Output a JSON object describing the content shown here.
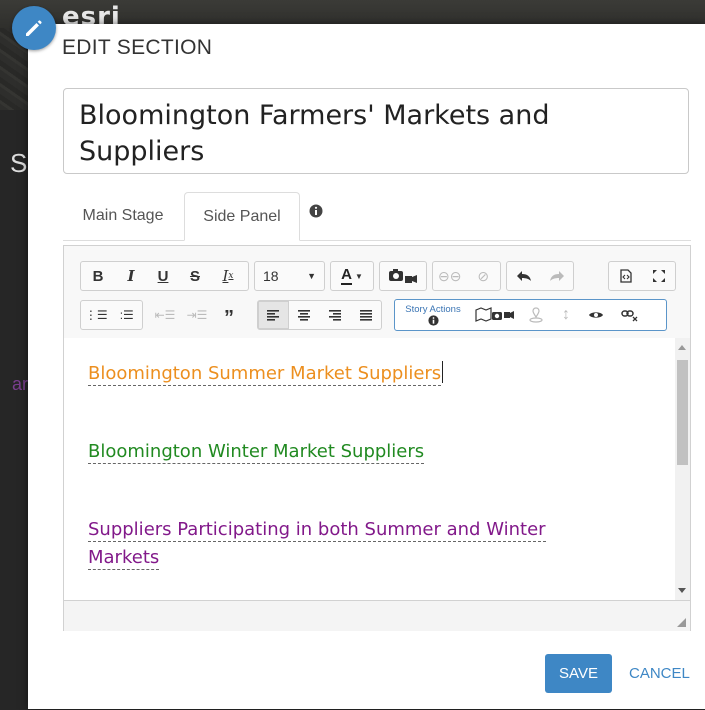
{
  "background": {
    "logo_text": "esri",
    "side_letter": "S",
    "side_fragment": "ar"
  },
  "dialog": {
    "title": "EDIT SECTION",
    "section_title_value": "Bloomington Farmers' Markets and Suppliers",
    "tabs": [
      {
        "label": "Main Stage",
        "active": false
      },
      {
        "label": "Side Panel",
        "active": true
      }
    ],
    "tab_info_icon": "info-circle-icon",
    "toolbar": {
      "font_size": "18",
      "story_actions_label": "Story Actions",
      "row1": [
        "bold",
        "italic",
        "underline",
        "strikethrough",
        "clear-format",
        "font-size",
        "text-color",
        "insert-media",
        "link",
        "unlink",
        "undo",
        "redo",
        "source",
        "maximize"
      ],
      "row2": [
        "numbered-list",
        "bulleted-list",
        "outdent",
        "indent",
        "blockquote",
        "align-left",
        "align-center",
        "align-right",
        "justify",
        "story-actions",
        "map-action",
        "media-action",
        "location-action",
        "navigate-action",
        "reveal-action",
        "remove-action"
      ]
    },
    "content": {
      "paragraphs": [
        {
          "text": "Bloomington Summer Market Suppliers",
          "color": "#ec8f1f"
        },
        {
          "text": "Bloomington Winter Market Suppliers",
          "color": "#218a21"
        },
        {
          "text": "Suppliers Participating in both Summer and Winter Markets",
          "color": "#82198a"
        }
      ]
    },
    "buttons": {
      "save": "SAVE",
      "cancel": "CANCEL"
    },
    "colors": {
      "accent": "#3e87c5"
    }
  }
}
